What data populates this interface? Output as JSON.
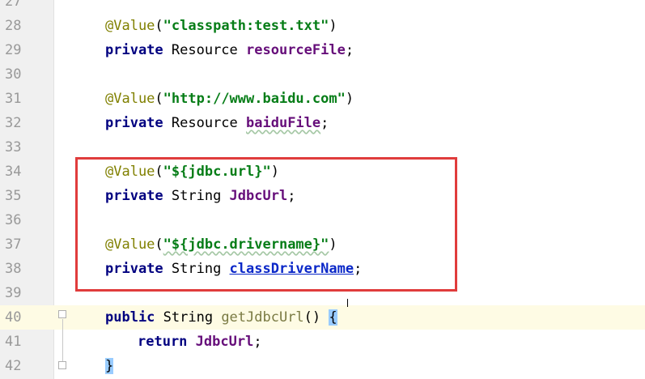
{
  "lines": [
    {
      "n": "27",
      "tokens": []
    },
    {
      "n": "28",
      "tokens": [
        [
          "ann",
          "@Value"
        ],
        [
          "punct",
          "("
        ],
        [
          "str",
          "\"classpath:test.txt\""
        ],
        [
          "punct",
          ")"
        ]
      ]
    },
    {
      "n": "29",
      "tokens": [
        [
          "kw",
          "private"
        ],
        [
          "type",
          " Resource "
        ],
        [
          "field",
          "resourceFile"
        ],
        [
          "punct",
          ";"
        ]
      ]
    },
    {
      "n": "30",
      "tokens": []
    },
    {
      "n": "31",
      "tokens": [
        [
          "ann",
          "@Value"
        ],
        [
          "punct",
          "("
        ],
        [
          "str",
          "\"http://www.baidu.com\""
        ],
        [
          "punct",
          ")"
        ]
      ]
    },
    {
      "n": "32",
      "tokens": [
        [
          "kw",
          "private"
        ],
        [
          "type",
          " Resource "
        ],
        [
          "field",
          "baiduFile"
        ],
        [
          "punct",
          ";"
        ]
      ]
    },
    {
      "n": "33",
      "tokens": []
    },
    {
      "n": "34",
      "tokens": [
        [
          "ann",
          "@Value"
        ],
        [
          "punct",
          "("
        ],
        [
          "str",
          "\"${jdbc.url}\""
        ],
        [
          "punct",
          ")"
        ]
      ]
    },
    {
      "n": "35",
      "tokens": [
        [
          "kw",
          "private"
        ],
        [
          "type",
          " String "
        ],
        [
          "field",
          "JdbcUrl"
        ],
        [
          "punct",
          ";"
        ]
      ]
    },
    {
      "n": "36",
      "tokens": []
    },
    {
      "n": "37",
      "tokens": [
        [
          "ann",
          "@Value"
        ],
        [
          "punct",
          "("
        ],
        [
          "str",
          "\"${jdbc.drivername}\""
        ],
        [
          "punct",
          ")"
        ]
      ]
    },
    {
      "n": "38",
      "tokens": [
        [
          "kw",
          "private"
        ],
        [
          "type",
          " String "
        ],
        [
          "field-link",
          "classDriverName"
        ],
        [
          "punct",
          ";"
        ]
      ]
    },
    {
      "n": "39",
      "tokens": []
    },
    {
      "n": "40",
      "tokens": [
        [
          "kw",
          "public"
        ],
        [
          "type",
          " String "
        ],
        [
          "method",
          "getJdbcUrl"
        ],
        [
          "punct",
          "() "
        ],
        [
          "brace",
          "{"
        ]
      ]
    },
    {
      "n": "41",
      "indent": true,
      "tokens": [
        [
          "kw",
          "return"
        ],
        [
          "type",
          " "
        ],
        [
          "field",
          "JdbcUrl"
        ],
        [
          "punct",
          ";"
        ]
      ]
    },
    {
      "n": "42",
      "tokens": [
        [
          "brace",
          "}"
        ]
      ]
    }
  ],
  "current_line": "40"
}
